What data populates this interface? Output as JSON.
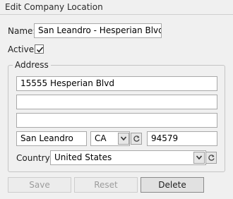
{
  "window": {
    "title": "Edit Company Location"
  },
  "form": {
    "name_label": "Name:",
    "name_value": "San Leandro - Hesperian Blvd",
    "active_label": "Active:",
    "active_checked": true
  },
  "address": {
    "legend": "Address",
    "line1": "15555 Hesperian Blvd",
    "line2": "",
    "line3": "",
    "city": "San Leandro",
    "state": "CA",
    "zip": "94579",
    "country_label": "Country:",
    "country": "United States"
  },
  "buttons": {
    "save": "Save",
    "reset": "Reset",
    "delete": "Delete"
  }
}
